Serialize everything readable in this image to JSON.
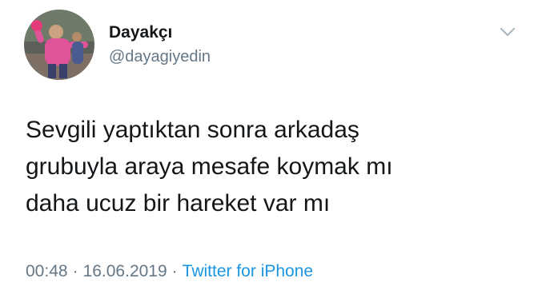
{
  "tweet": {
    "author": {
      "display_name": "Dayakçı",
      "handle": "@dayagiyedin",
      "avatar": "avatar-photo"
    },
    "menu_icon": "chevron-down-icon",
    "text_lines": [
      "Sevgili yaptıktan sonra arkadaş",
      "grubuyla araya mesafe koymak mı",
      "daha ucuz bir hareket var mı"
    ],
    "time": "00:48",
    "separator": "·",
    "date": "16.06.2019",
    "source": "Twitter for iPhone"
  },
  "colors": {
    "text": "#14171a",
    "secondary": "#657786",
    "link": "#1b95e0"
  }
}
